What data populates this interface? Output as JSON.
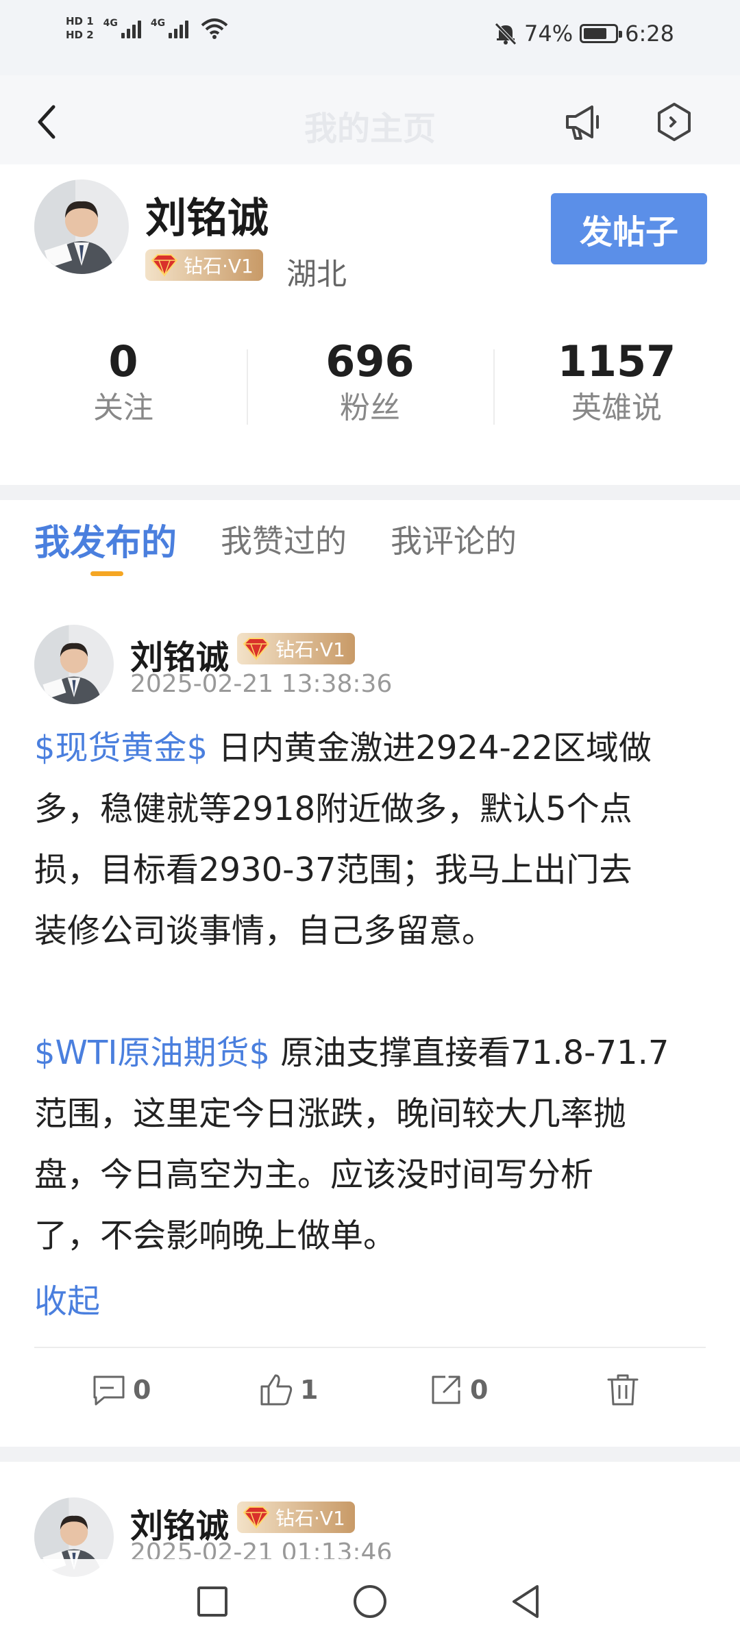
{
  "status_bar": {
    "hd1": "HD 1",
    "hd2": "HD 2",
    "net1": "4G",
    "net2": "4G",
    "battery_percent": "74%",
    "battery_level": 0.74,
    "time": "6:28"
  },
  "header": {
    "title": "我的主页"
  },
  "profile": {
    "name": "刘铭诚",
    "badge": "钻石·V1",
    "region": "湖北",
    "post_button": "发帖子",
    "stats": [
      {
        "value": "0",
        "label": "关注"
      },
      {
        "value": "696",
        "label": "粉丝"
      },
      {
        "value": "1157",
        "label": "英雄说"
      }
    ]
  },
  "tabs": [
    "我发布的",
    "我赞过的",
    "我评论的"
  ],
  "posts": [
    {
      "author": "刘铭诚",
      "badge": "钻石·V1",
      "time": "2025-02-21 13:38:36",
      "lines": [
        {
          "tag": "$现货黄金$",
          "text": " 日内黄金激进2924-22区域做"
        },
        {
          "tag": "",
          "text": "多，稳健就等2918附近做多，默认5个点"
        },
        {
          "tag": "",
          "text": "损，目标看2930-37范围；我马上出门去"
        },
        {
          "tag": "",
          "text": "装修公司谈事情，自己多留意。"
        },
        {
          "tag": "",
          "text": ""
        },
        {
          "tag": "$WTI原油期货$",
          "text": " 原油支撑直接看71.8-71.7"
        },
        {
          "tag": "",
          "text": "范围，这里定今日涨跌，晚间较大几率抛"
        },
        {
          "tag": "",
          "text": "盘，今日高空为主。应该没时间写分析"
        },
        {
          "tag": "",
          "text": "了，不会影响晚上做单。"
        }
      ],
      "collapse": "收起",
      "comments": "0",
      "likes": "1",
      "shares": "0"
    },
    {
      "author": "刘铭诚",
      "badge": "钻石·V1",
      "time": "2025-02-21 01:13:46"
    }
  ],
  "colors": {
    "accent": "#4a7fde",
    "button": "#5b8fe8",
    "tab_indicator": "#f5a623"
  }
}
